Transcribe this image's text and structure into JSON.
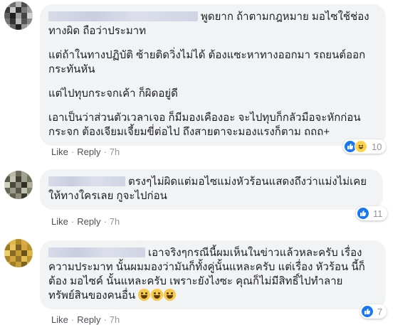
{
  "colors": {
    "bubble_bg": "#f2f3f5",
    "like_blue": "#1877f2",
    "action_gray": "#90949c"
  },
  "comments": [
    {
      "author": "",
      "paragraphs": [
        "พูดยาก ถ้าตามกฎหมาย มอไซใช้ช่องทางผิด ถือว่าประมาท",
        "แต่ถ้าในทางปฏิบัติ ซ้ายติดวิ่งไม่ได้ ต้องแซะหาทางออกมา รถยนต์ออกกระทันหัน",
        "แต่ไปทุบกระจกเค้า ก็ผิดอยู่ดี",
        "เอาเป็นว่าส่วนตัวเวลาเจอ ก็มีมองเคืองอะ จะไปทุบก็กลัวมือจะหักก่อน กระจก ต้องเจียมเจี้ยมขี่ต่อไป ถึงสายตาจะมองแรงก็ตาม ถถถ+"
      ],
      "actions": {
        "like": "Like",
        "reply": "Reply",
        "time": "7h"
      },
      "reactions": {
        "icons": [
          "like-icon",
          "haha-icon"
        ],
        "count": "10"
      }
    },
    {
      "author": "",
      "paragraphs": [
        "ตรงๆไม่ผิดแต่มอไซแม่งหัวร้อนแสดงถึงว่าแม่งไม่เคยให้ทางใครเลย กูจะไปก่อน"
      ],
      "actions": {
        "like": "Like",
        "reply": "Reply",
        "time": "7h"
      },
      "reactions": {
        "icons": [
          "like-icon"
        ],
        "count": "11"
      }
    },
    {
      "author": "",
      "paragraphs": [
        "เอาจริงๆกรณีนี้ผมเห็นในข่าวแล้วหละครับ เรื่อง ความประมาท นั้นผมมองว่ามันก็ทั้งคู่นั้นแหละครับ แต่เรื่อง หัวร้อน นี้ก็ต้อง มอไซค์ นั้นแหละครับ เพราะยังไงซะ คุณก็ไม่มีสิทธิ์ไปทำลายทรัพย์สินของคนอื่น"
      ],
      "emoji_icons": [
        "grinning-face-icon",
        "grinning-face-icon",
        "grinning-face-icon"
      ],
      "actions": {
        "like": "Like",
        "reply": "Reply",
        "time": "7h"
      },
      "reactions": {
        "icons": [
          "like-icon"
        ],
        "count": "7"
      }
    }
  ]
}
